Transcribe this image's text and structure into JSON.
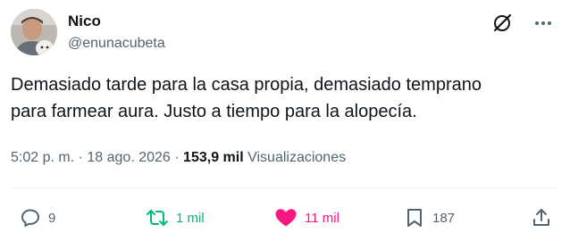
{
  "author": {
    "display_name": "Nico",
    "handle": "@enunacubeta"
  },
  "tweet": {
    "text": "Demasiado tarde para la casa propia, demasiado temprano\npara farmear aura. Justo a tiempo para la alopecía."
  },
  "meta": {
    "time": "5:02 p. m.",
    "separator": "·",
    "date": "18 ago. 2026",
    "views_count": "153,9 mil",
    "views_label": "Visualizaciones"
  },
  "actions": {
    "replies": "9",
    "reposts": "1 mil",
    "likes": "11 mil",
    "bookmarks": "187"
  },
  "icons": {
    "grok": "grok-icon",
    "more": "more-icon",
    "reply": "reply-icon",
    "repost": "repost-icon",
    "like": "heart-icon",
    "bookmark": "bookmark-icon",
    "share": "share-icon"
  },
  "colors": {
    "text_primary": "#0f1419",
    "text_secondary": "#536471",
    "repost_active": "#00ba7c",
    "like_active": "#f91880"
  }
}
